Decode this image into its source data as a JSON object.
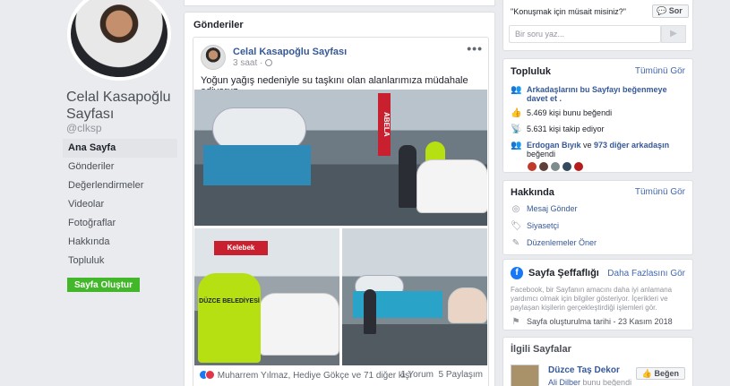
{
  "profile": {
    "name": "Celal Kasapoğlu Sayfası",
    "handle": "@clksp"
  },
  "nav": {
    "items": [
      {
        "label": "Ana Sayfa"
      },
      {
        "label": "Gönderiler"
      },
      {
        "label": "Değerlendirmeler"
      },
      {
        "label": "Videolar"
      },
      {
        "label": "Fotoğraflar"
      },
      {
        "label": "Hakkında"
      },
      {
        "label": "Topluluk"
      }
    ],
    "create_button": "Sayfa Oluştur"
  },
  "feed": {
    "section_title": "Gönderiler",
    "post": {
      "author": "Celal Kasapoğlu Sayfası",
      "time": "3 saat ·",
      "text": "Yoğun yağış nedeniyle su taşkını olan alanlarımıza müdahale ediyoruz.",
      "photo_sign_1": "ABELA",
      "photo_sign_2": "Kelebek",
      "vest_text": "DÜZCE BELEDİYESİ",
      "reactions_text": "Muharrem Yılmaz, Hediye Gökçe ve 71 diğer kişi",
      "comments": "1 Yorum",
      "shares": "5 Paylaşım"
    }
  },
  "messenger": {
    "prompt": "\"Konuşmak için müsait misiniz?\"",
    "ask_button": "Sor",
    "input_placeholder": "Bir soru yaz...",
    "send_label": "▶"
  },
  "community": {
    "title": "Topluluk",
    "see_all": "Tümünü Gör",
    "invite": "Arkadaşlarını bu Sayfayı beğenmeye davet et .",
    "likes": "5.469 kişi bunu beğendi",
    "follows": "5.631 kişi takip ediyor",
    "friend_names": "Erdogan Bıyık",
    "friend_connector": " ve ",
    "friend_others": "973 diğer arkadaşın",
    "friend_suffix": "beğendi",
    "avatar_colors": [
      "#c0392b",
      "#5d4037",
      "#7f8c8d",
      "#34495e",
      "#b71c1c"
    ]
  },
  "about": {
    "title": "Hakkında",
    "see_all": "Tümünü Gör",
    "message": "Mesaj Gönder",
    "category": "Siyasetçi",
    "suggest": "Düzenlemeler Öner"
  },
  "transparency": {
    "title": "Sayfa Şeffaflığı",
    "more": "Daha Fazlasını Gör",
    "description": "Facebook, bir Sayfanın amacını daha iyi anlamana yardımcı olmak için bilgiler gösteriyor. İçerikleri ve paylaşan kişilerin gerçekleştirdiği işlemleri gör.",
    "created": "Sayfa oluşturulma tarihi - 23 Kasım 2018"
  },
  "liked_pages": {
    "title": "İlgili Sayfalar",
    "page_name": "Düzce Taş Dekor",
    "page_sub_name": "Ali Dilber",
    "page_sub_rest": " bunu beğendi",
    "like_button": "Beğen"
  }
}
